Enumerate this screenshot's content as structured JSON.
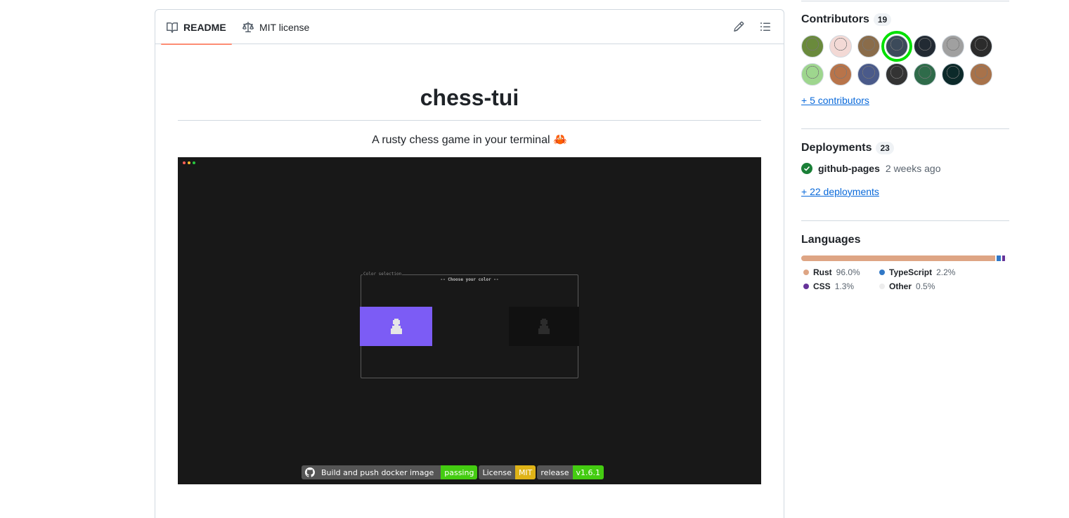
{
  "readme": {
    "tabs": [
      {
        "label": "README",
        "icon": "book-icon",
        "active": true
      },
      {
        "label": "MIT license",
        "icon": "law-icon",
        "active": false
      }
    ],
    "title": "chess-tui",
    "subtitle": "A rusty chess game in your terminal 🦀",
    "terminal": {
      "box_label": "Color selection",
      "box_heading": "-- Choose your color --",
      "highlight_color": "#7c5cf5"
    },
    "badges": [
      {
        "label": "Build and push docker image",
        "value": "passing",
        "color": "#44cc11"
      },
      {
        "label": "License",
        "value": "MIT",
        "color": "#dfb317"
      },
      {
        "label": "release",
        "value": "v1.6.1",
        "color": "#44cc11"
      }
    ]
  },
  "sidebar": {
    "contributors": {
      "title": "Contributors",
      "count": "19",
      "more_link": "+ 5 contributors",
      "avatar_colors": [
        "#6a8a3c",
        "#f3d9d5",
        "#8a6c4a",
        "#3c4a5a",
        "#222a33",
        "#a0a0a0",
        "#2b2b2b",
        "#9ed68e",
        "#b8744a",
        "#4a5a8a",
        "#333333",
        "#2f6b4a",
        "#0c2a2a",
        "#a8724a"
      ],
      "highlighted_index": 3
    },
    "deployments": {
      "title": "Deployments",
      "count": "23",
      "items": [
        {
          "name": "github-pages",
          "time": "2 weeks ago",
          "status": "success"
        }
      ],
      "more_link": "+ 22 deployments"
    },
    "languages": {
      "title": "Languages",
      "items": [
        {
          "name": "Rust",
          "percent": "96.0%",
          "value": 96.0,
          "color": "#dea584"
        },
        {
          "name": "TypeScript",
          "percent": "2.2%",
          "value": 2.2,
          "color": "#3178c6"
        },
        {
          "name": "CSS",
          "percent": "1.3%",
          "value": 1.3,
          "color": "#663399"
        },
        {
          "name": "Other",
          "percent": "0.5%",
          "value": 0.5,
          "color": "#ededed"
        }
      ]
    }
  }
}
